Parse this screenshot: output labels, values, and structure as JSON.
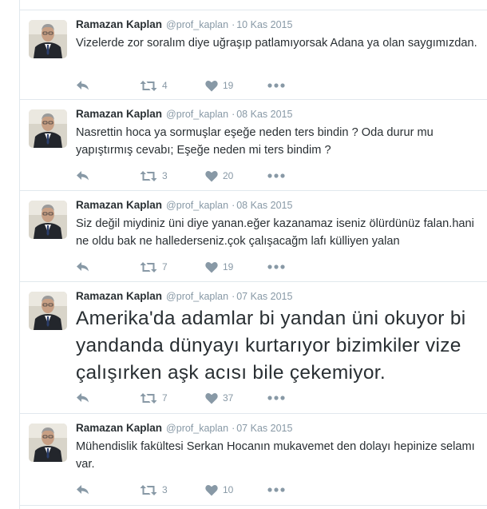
{
  "tweets": [
    {
      "name": "Ramazan Kaplan",
      "handle": "@prof_kaplan",
      "separator": "·",
      "date": "10 Kas 2015",
      "text": "Vizelerde zor soralım diye uğraşıp patlamıyorsak Adana ya olan saygımızdan.",
      "retweets": "4",
      "likes": "19"
    },
    {
      "name": "Ramazan Kaplan",
      "handle": "@prof_kaplan",
      "separator": "·",
      "date": "08 Kas 2015",
      "text": "Nasrettin hoca ya sormuşlar eşeğe neden ters bindin ? Oda durur mu yapıştırmış cevabı; Eşeğe neden mi ters bindim ?",
      "retweets": "3",
      "likes": "20"
    },
    {
      "name": "Ramazan Kaplan",
      "handle": "@prof_kaplan",
      "separator": "·",
      "date": "08 Kas 2015",
      "text": "Siz değil miydiniz üni diye yanan.eğer kazanamaz iseniz ölürdünüz falan.hani ne oldu bak ne hallederseniz.çok çalışacağm lafı külliyen yalan",
      "retweets": "7",
      "likes": "19"
    },
    {
      "name": "Ramazan Kaplan",
      "handle": "@prof_kaplan",
      "separator": "·",
      "date": "07 Kas 2015",
      "text": "Amerika'da adamlar bi yandan üni okuyor bi yandanda dünyayı kurtarıyor bizimkiler vize çalışırken aşk acısı bile çekemiyor.",
      "retweets": "7",
      "likes": "37"
    },
    {
      "name": "Ramazan Kaplan",
      "handle": "@prof_kaplan",
      "separator": "·",
      "date": "07 Kas 2015",
      "text": "Mühendislik fakültesi Serkan Hocanın mukavemet den dolayı hepinize selamı var.",
      "retweets": "3",
      "likes": "10"
    }
  ],
  "colors": {
    "icon": "#8899a6",
    "border": "#e1e8ed",
    "text": "#292f33"
  },
  "icons": {
    "reply": "reply-icon",
    "retweet": "retweet-icon",
    "like": "heart-icon",
    "more": "more-icon"
  }
}
